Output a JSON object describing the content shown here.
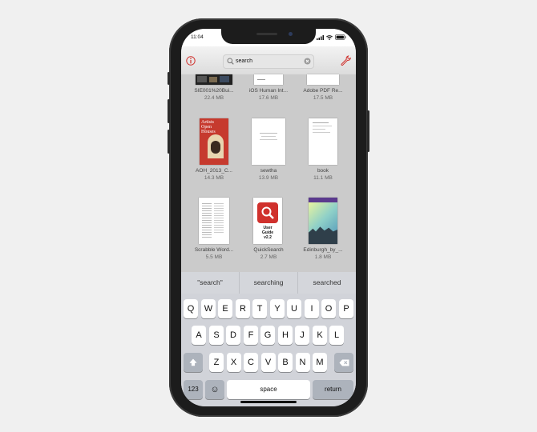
{
  "status": {
    "time": "11:04"
  },
  "search": {
    "value": "search"
  },
  "files": [
    {
      "name": "SIE001%20Bui...",
      "size": "22.4 MB",
      "thumb": "photo"
    },
    {
      "name": "iOS Human Int...",
      "size": "17.6 MB",
      "thumb": "doc"
    },
    {
      "name": "Adobe PDF Re...",
      "size": "17.5 MB",
      "thumb": "doc"
    },
    {
      "name": "AOH_2013_C...",
      "size": "14.3 MB",
      "thumb": "red-cover"
    },
    {
      "name": "sewtha",
      "size": "13.9 MB",
      "thumb": "doc"
    },
    {
      "name": "book",
      "size": "11.1 MB",
      "thumb": "doc"
    },
    {
      "name": "Scrabble Word...",
      "size": "5.5 MB",
      "thumb": "doc"
    },
    {
      "name": "QuickSearch",
      "size": "2.7 MB",
      "thumb": "quicksearch"
    },
    {
      "name": "Edinburgh_by_...",
      "size": "1.8 MB",
      "thumb": "edinburgh"
    }
  ],
  "thumb_text": {
    "aoh_title": "Artists Open Houses",
    "quicksearch": "User Guide v2.2"
  },
  "suggestions": [
    "\"search\"",
    "searching",
    "searched"
  ],
  "keyboard": {
    "row1": [
      "Q",
      "W",
      "E",
      "R",
      "T",
      "Y",
      "U",
      "I",
      "O",
      "P"
    ],
    "row2": [
      "A",
      "S",
      "D",
      "F",
      "G",
      "H",
      "J",
      "K",
      "L"
    ],
    "row3": [
      "Z",
      "X",
      "C",
      "V",
      "B",
      "N",
      "M"
    ],
    "numbers_label": "123",
    "space_label": "space",
    "return_label": "return",
    "emoji": "☺"
  },
  "colors": {
    "accent_red": "#d0312d",
    "toolbar": "#e6e6e6",
    "keyboard_bg": "#d1d3d9"
  }
}
